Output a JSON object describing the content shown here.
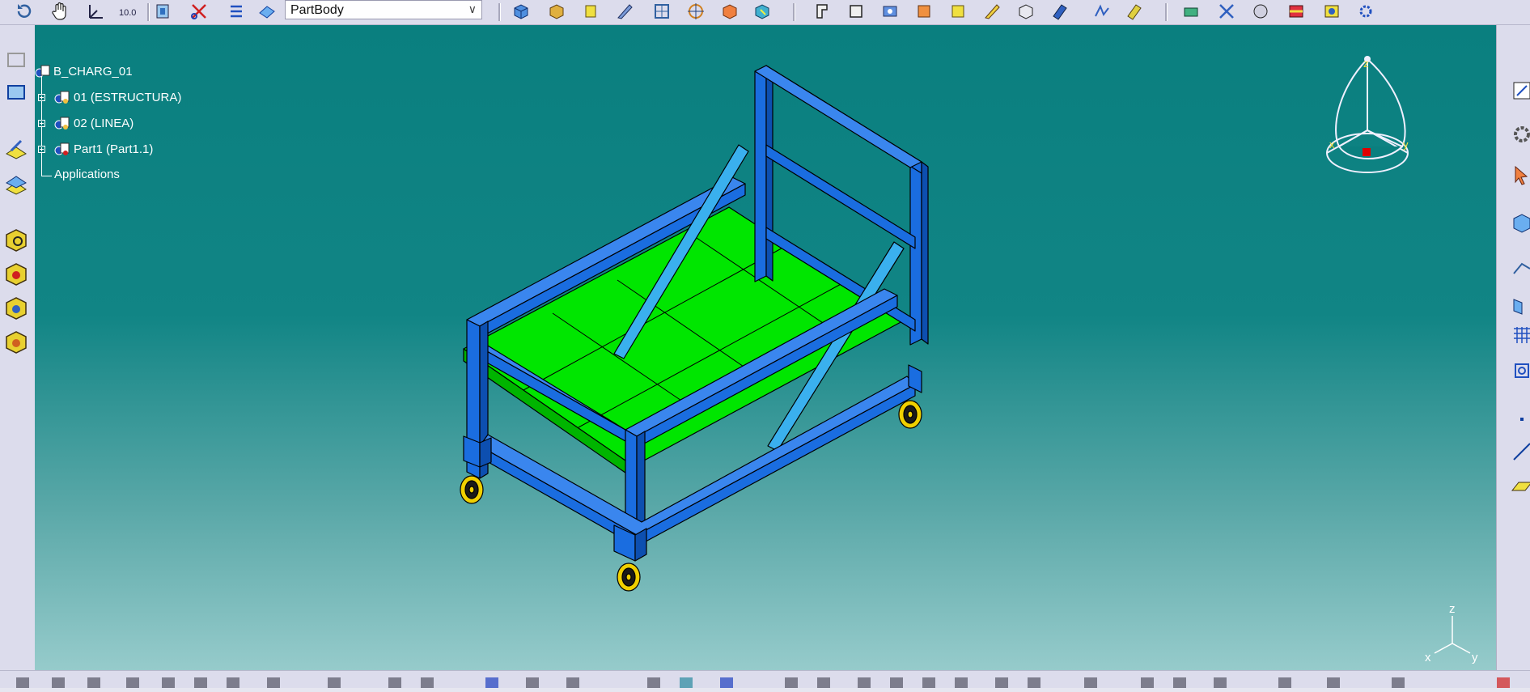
{
  "toolbar": {
    "current_body": "PartBody",
    "icons": [
      "undo-icon",
      "pan-hand-icon",
      "axis-icon",
      "measure-icon",
      "sketch-plane-icon",
      "cut-icon",
      "list-icon",
      "surface-icon",
      "box-icon",
      "extrude-icon",
      "cylinder-icon",
      "wedge-icon",
      "target-icon",
      "snap-icon",
      "cube-icon",
      "bracket-icon",
      "frame-icon",
      "beam-icon",
      "hole-icon",
      "drill-icon",
      "draft-icon",
      "fillet-icon",
      "shell-icon",
      "sweep-icon",
      "loft-icon",
      "transform-icon",
      "pattern-icon",
      "mirror-icon",
      "analysis-icon",
      "render-icon",
      "settings-icon"
    ]
  },
  "tree": {
    "root": "B_CHARG_01",
    "children": [
      "01 (ESTRUCTURA)",
      "02 (LINEA)",
      "Part1 (Part1.1)"
    ],
    "applications": "Applications"
  },
  "compass": {
    "x_label": "x",
    "y_label": "y",
    "z_label": "z"
  },
  "axis_triad": {
    "x_label": "x",
    "y_label": "y",
    "z_label": "z"
  },
  "colors": {
    "viewport_top": "#0a7f7f",
    "viewport_bottom": "#96cbcb",
    "frame_blue": "#1a6de0",
    "brace_light_blue": "#3ab0ee",
    "floor_green": "#00e600",
    "wheel_yellow": "#f0d000"
  }
}
